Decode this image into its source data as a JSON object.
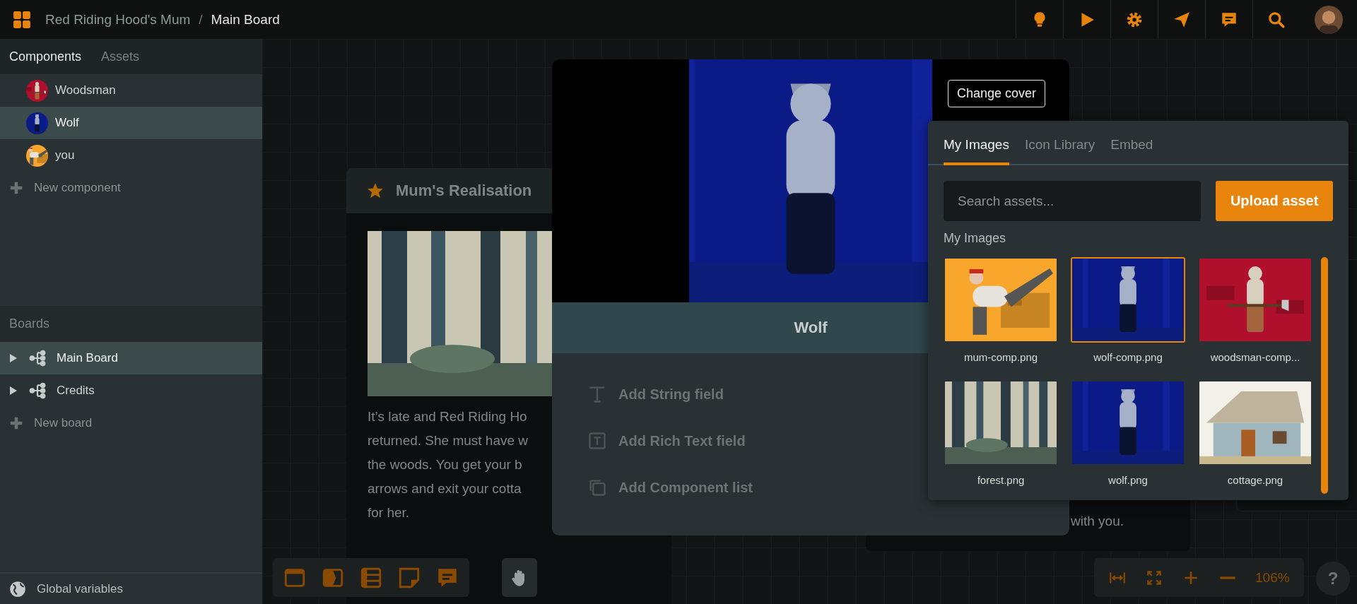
{
  "breadcrumb": {
    "separator": "/",
    "items": [
      {
        "label": "Red Riding Hood's Mum",
        "selected": false
      },
      {
        "label": "Main Board",
        "selected": true
      }
    ]
  },
  "sidebar": {
    "tabs": [
      {
        "label": "Components",
        "selected": true
      },
      {
        "label": "Assets",
        "selected": false
      }
    ],
    "components": [
      {
        "label": "Woodsman",
        "selected": false
      },
      {
        "label": "Wolf",
        "selected": true
      },
      {
        "label": "you",
        "selected": false
      }
    ],
    "new_component": "New component",
    "boards_heading": "Boards",
    "boards": [
      {
        "label": "Main Board",
        "selected": true
      },
      {
        "label": "Credits",
        "selected": false
      }
    ],
    "new_board": "New board",
    "global_variables": "Global variables"
  },
  "canvas": {
    "card": {
      "title": "Mum's Realisation",
      "lines": [
        "It’s late and Red Riding Ho",
        "returned. She must have w",
        "the woods. You get your b",
        "arrows and exit your cotta",
        "for her."
      ]
    },
    "card_2": {
      "text": "with you."
    }
  },
  "modal": {
    "change_cover": "Change cover",
    "title": "Wolf",
    "actions": [
      {
        "label": "Add String field",
        "kind": "string"
      },
      {
        "label": "Add Rich Text field",
        "kind": "rich"
      },
      {
        "label": "Add Component list",
        "kind": "list"
      }
    ]
  },
  "asset_picker": {
    "tabs": [
      {
        "label": "My Images",
        "selected": true
      },
      {
        "label": "Icon Library",
        "selected": false
      },
      {
        "label": "Embed",
        "selected": false
      }
    ],
    "search": {
      "placeholder": "Search assets..."
    },
    "upload": "Upload asset",
    "section": "My Images",
    "images": [
      {
        "caption": "mum-comp.png",
        "selected": false
      },
      {
        "caption": "wolf-comp.png",
        "selected": true
      },
      {
        "caption": "woodsman-comp...",
        "selected": false
      },
      {
        "caption": "forest.png",
        "selected": false
      },
      {
        "caption": "wolf.png",
        "selected": false
      },
      {
        "caption": "cottage.png",
        "selected": false
      }
    ]
  },
  "zoom_level": "106%",
  "help": "?"
}
